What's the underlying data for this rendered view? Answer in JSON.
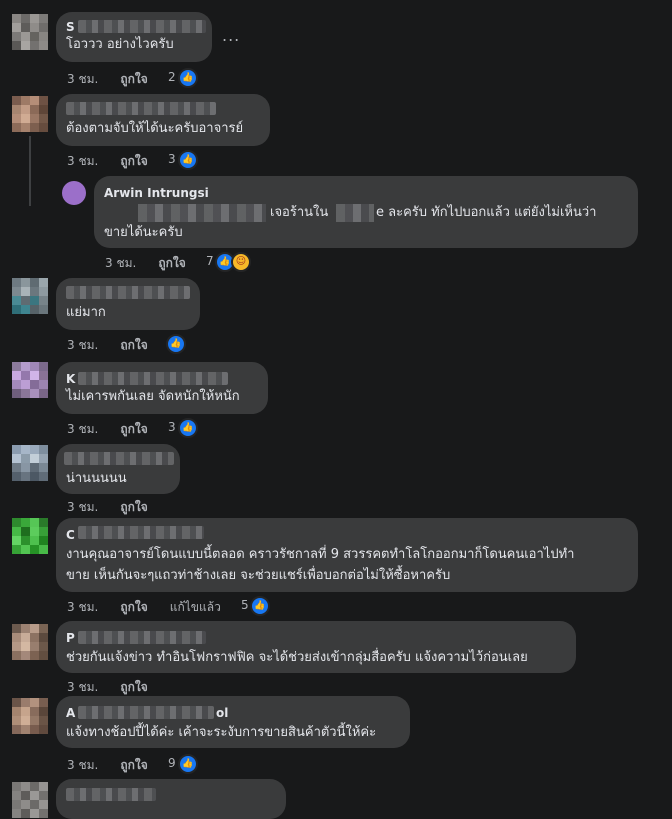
{
  "comments": [
    {
      "name_lead": "S",
      "text": "โอววว อย่างไวครับ",
      "time": "3 ชม.",
      "like": "ถูกใจ",
      "count": "2",
      "more": "..."
    },
    {
      "name_lead": "",
      "text": "ต้องตามจับให้ได้นะครับอาจารย์",
      "time": "3 ชม.",
      "like": "ถูกใจ",
      "count": "3"
    },
    {
      "name": "Arwin Intrungsi",
      "text_line1_suffix": "เจอร้านใน",
      "text_line1_mid": "e ละครับ ทักไปบอกแล้ว แต่ยังไม่เห็นว่า",
      "text_line2": "ขายได้นะครับ",
      "time": "3 ชม.",
      "like": "ถูกใจ",
      "count": "7"
    },
    {
      "name_lead": "",
      "text": "แย่มาก",
      "time": "3 ชม.",
      "like": "ถูกใจ"
    },
    {
      "name_lead": "K",
      "text": "ไม่เคารพกันเลย จัดหนักให้หนัก",
      "time": "3 ชม.",
      "like": "ถูกใจ",
      "count": "3"
    },
    {
      "name_lead": "",
      "text": "น่านนนนน",
      "time": "3 ชม.",
      "like": "ถูกใจ"
    },
    {
      "name_lead": "C",
      "text_line1": "งานคุณอาจารย์โดนแบบนี้ตลอด คราวรัชกาลที่ 9 สวรรคตทำโลโกออกมาก็โดนคนเอาไปทำ",
      "text_line2": "ขาย เห็นกันจะๆแถวท่าช้างเลย จะช่วยแชร์เพื่อบอกต่อไม่ให้ซื้อหาครับ",
      "time": "3 ชม.",
      "like": "ถูกใจ",
      "edited": "แก้ไขแล้ว",
      "count": "5"
    },
    {
      "name_lead": "P",
      "text": "ช่วยกันแจ้งข่าว ทำอินโฟกราฟฟิค จะได้ช่วยส่งเข้ากลุ่มสื่อครับ แจ้งความไว้ก่อนเลย",
      "time": "3 ชม.",
      "like": "ถูกใจ"
    },
    {
      "name_lead": "A",
      "name_tail": "ol",
      "text": "แจ้งทางช้อปปี้ได้ค่ะ เค้าจะระงับการขายสินค้าตัวนี้ให้ค่ะ",
      "time": "3 ชม.",
      "like": "ถูกใจ",
      "count": "9"
    }
  ],
  "colors": {
    "background": "#18191a",
    "bubble": "#3a3b3c",
    "text": "#e4e6eb",
    "meta": "#b0b3b8",
    "like_blue": "#1877f2",
    "haha_yellow": "#f7b928"
  }
}
